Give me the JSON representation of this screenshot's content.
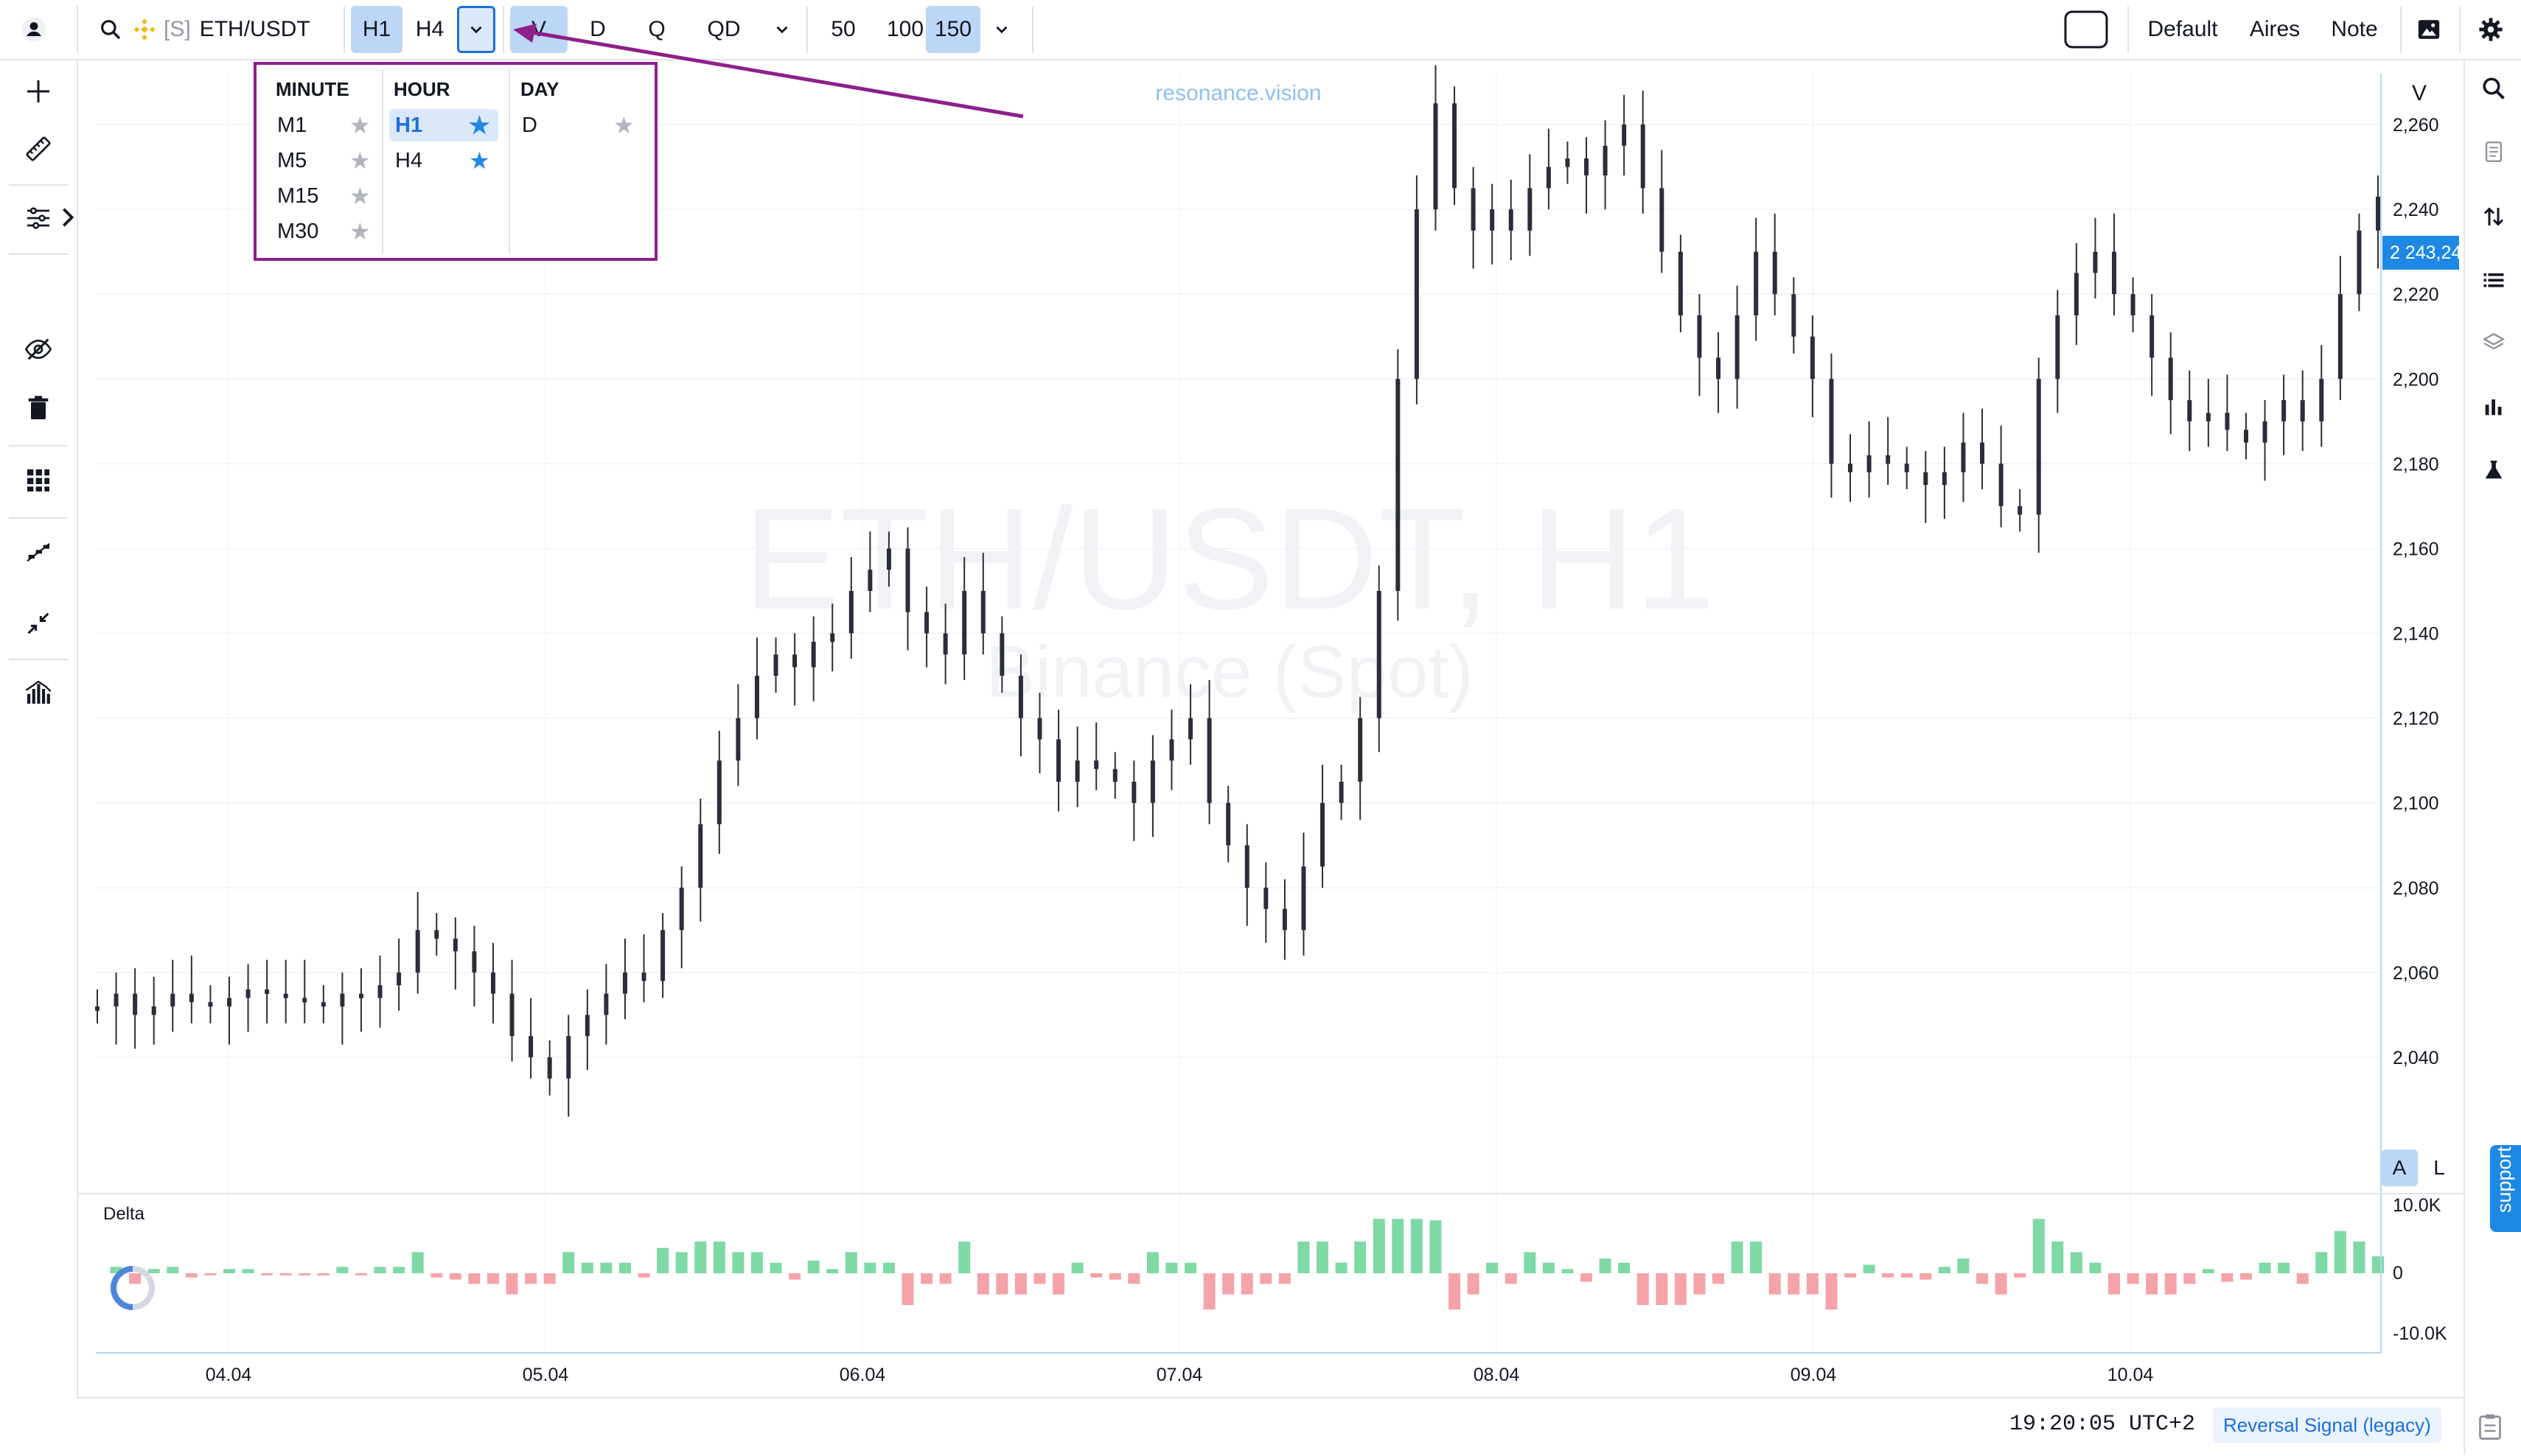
{
  "toolbar": {
    "symbol": "ETH/USDT",
    "symbol_prefix": "[S]",
    "timeframes": [
      "H1",
      "H4"
    ],
    "active_timeframe": "H1",
    "ranges": [
      "V",
      "D",
      "Q",
      "QD"
    ],
    "active_range": "V",
    "counts": [
      "50",
      "100",
      "150"
    ],
    "active_count": "150",
    "layout_label": "Default",
    "aires_label": "Aires",
    "note_label": "Note"
  },
  "timeframe_popup": {
    "columns": [
      {
        "header": "MINUTE",
        "items": [
          {
            "label": "M1",
            "fav": false
          },
          {
            "label": "M5",
            "fav": false
          },
          {
            "label": "M15",
            "fav": false
          },
          {
            "label": "M30",
            "fav": false
          }
        ]
      },
      {
        "header": "HOUR",
        "items": [
          {
            "label": "H1",
            "fav": true,
            "selected": true
          },
          {
            "label": "H4",
            "fav": true
          }
        ]
      },
      {
        "header": "DAY",
        "items": [
          {
            "label": "D",
            "fav": false
          }
        ]
      }
    ]
  },
  "chart": {
    "watermark_main": "ETH/USDT, H1",
    "watermark_sub": "Binance (Spot)",
    "brand_text": "resonance.vision",
    "price_tag": "2 243,24",
    "axis_mode_a": "A",
    "axis_mode_l": "L",
    "axis_top_label": "V",
    "accent": "#1e88e5",
    "up_color": "#7ed9a4",
    "down_color": "#f4a3a8",
    "candle_color": "#2a2e39"
  },
  "chart_data": {
    "type": "bar",
    "y_ticks": [
      "2,260",
      "2,240",
      "2,220",
      "2,200",
      "2,180",
      "2,160",
      "2,140",
      "2,120",
      "2,100",
      "2,080",
      "2,060",
      "2,040"
    ],
    "ylim": [
      2020,
      2272
    ],
    "x_ticks": [
      "04.04",
      "05.04",
      "06.04",
      "07.04",
      "08.04",
      "09.04",
      "10.04"
    ],
    "price_path": [
      2052,
      2055,
      2050,
      2052,
      2055,
      2053,
      2052,
      2054,
      2056,
      2055,
      2054,
      2053,
      2052,
      2055,
      2054,
      2057,
      2060,
      2070,
      2068,
      2065,
      2060,
      2055,
      2045,
      2040,
      2035,
      2045,
      2050,
      2055,
      2060,
      2058,
      2070,
      2080,
      2095,
      2110,
      2120,
      2130,
      2135,
      2132,
      2138,
      2140,
      2150,
      2155,
      2160,
      2145,
      2140,
      2135,
      2150,
      2140,
      2130,
      2120,
      2115,
      2105,
      2110,
      2108,
      2105,
      2100,
      2110,
      2115,
      2120,
      2100,
      2090,
      2080,
      2075,
      2070,
      2085,
      2100,
      2105,
      2120,
      2150,
      2200,
      2240,
      2265,
      2245,
      2235,
      2240,
      2235,
      2245,
      2250,
      2252,
      2248,
      2255,
      2260,
      2245,
      2230,
      2215,
      2205,
      2200,
      2215,
      2230,
      2220,
      2210,
      2200,
      2180,
      2178,
      2182,
      2180,
      2178,
      2175,
      2178,
      2185,
      2180,
      2170,
      2168,
      2200,
      2215,
      2225,
      2230,
      2220,
      2215,
      2205,
      2195,
      2190,
      2192,
      2188,
      2185,
      2190,
      2195,
      2190,
      2200,
      2220,
      2235,
      2243
    ],
    "delta_label": "Delta",
    "delta_ticks": [
      "10.0K",
      "0",
      "-10.0K"
    ],
    "delta_ylim": [
      -10,
      10
    ]
  },
  "status": {
    "time": "19:20:05 UTC+2",
    "indicator": "Reversal Signal (legacy)"
  },
  "sidebar": {
    "support_label": "support"
  }
}
